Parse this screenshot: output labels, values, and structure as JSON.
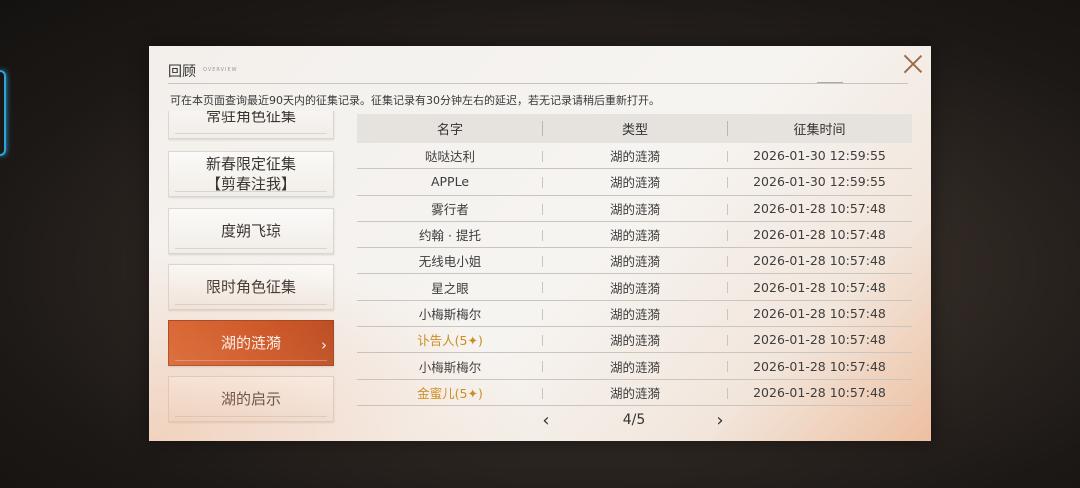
{
  "dialog": {
    "title": "回顾",
    "title_en": "OVERVIEW",
    "subtitle": "可在本页面查询最近90天内的征集记录。征集记录有30分钟左右的延迟，若无记录请稍后重新打开。"
  },
  "sidebar": {
    "items": [
      {
        "label": "常驻角色征集",
        "active": false
      },
      {
        "label": "新春限定征集\n【剪春注我】",
        "active": false
      },
      {
        "label": "度朔飞琼",
        "active": false
      },
      {
        "label": "限时角色征集",
        "active": false
      },
      {
        "label": "湖的涟漪",
        "active": true
      },
      {
        "label": "湖的启示",
        "active": false
      }
    ]
  },
  "table": {
    "headers": [
      "名字",
      "类型",
      "征集时间"
    ],
    "rows": [
      {
        "name": "哒哒达利",
        "type": "湖的涟漪",
        "time": "2026-01-30 12:59:55",
        "gold": false
      },
      {
        "name": "APPLe",
        "type": "湖的涟漪",
        "time": "2026-01-30 12:59:55",
        "gold": false
      },
      {
        "name": "雾行者",
        "type": "湖的涟漪",
        "time": "2026-01-28 10:57:48",
        "gold": false
      },
      {
        "name": "约翰 · 提托",
        "type": "湖的涟漪",
        "time": "2026-01-28 10:57:48",
        "gold": false
      },
      {
        "name": "无线电小姐",
        "type": "湖的涟漪",
        "time": "2026-01-28 10:57:48",
        "gold": false
      },
      {
        "name": "星之眼",
        "type": "湖的涟漪",
        "time": "2026-01-28 10:57:48",
        "gold": false
      },
      {
        "name": "小梅斯梅尔",
        "type": "湖的涟漪",
        "time": "2026-01-28 10:57:48",
        "gold": false
      },
      {
        "name": "讣告人(5✦)",
        "type": "湖的涟漪",
        "time": "2026-01-28 10:57:48",
        "gold": true
      },
      {
        "name": "小梅斯梅尔",
        "type": "湖的涟漪",
        "time": "2026-01-28 10:57:48",
        "gold": false
      },
      {
        "name": "金蜜儿(5✦)",
        "type": "湖的涟漪",
        "time": "2026-01-28 10:57:48",
        "gold": true
      }
    ]
  },
  "pager": {
    "text": "4/5",
    "prev": "‹",
    "next": "›"
  },
  "colors": {
    "accent": "#c84a1a",
    "gold_text": "#c98d1f"
  }
}
